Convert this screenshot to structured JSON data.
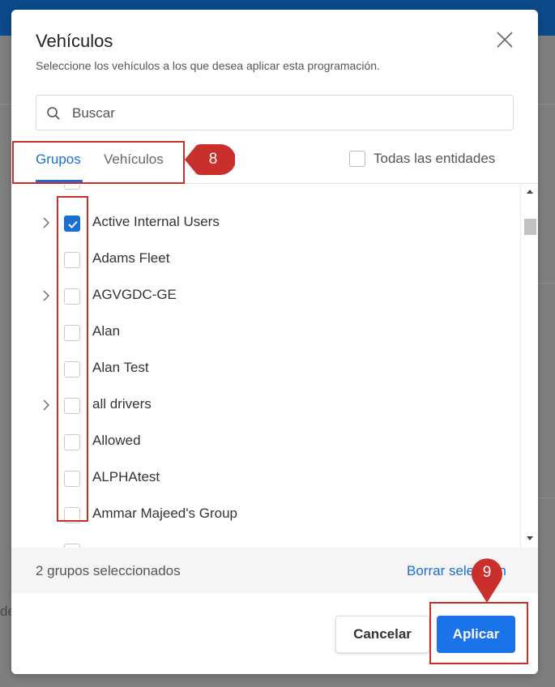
{
  "backdrop": {
    "partial_text": "de"
  },
  "dialog": {
    "title": "Vehículos",
    "subtitle": "Seleccione los vehículos a los que desea aplicar esta programación.",
    "close_icon": "close-icon"
  },
  "search": {
    "placeholder": "Buscar",
    "value": "",
    "icon": "search-icon"
  },
  "tabs": [
    {
      "label": "Grupos",
      "active": true
    },
    {
      "label": "Vehículos",
      "active": false
    }
  ],
  "all_entities": {
    "label": "Todas las entidades",
    "checked": false
  },
  "groups": [
    {
      "label": "Active Internal Users",
      "checked": true,
      "expandable": true
    },
    {
      "label": "Adams Fleet",
      "checked": false,
      "expandable": false
    },
    {
      "label": "AGVGDC-GE",
      "checked": false,
      "expandable": true
    },
    {
      "label": "Alan",
      "checked": false,
      "expandable": false
    },
    {
      "label": "Alan Test",
      "checked": false,
      "expandable": false
    },
    {
      "label": "all drivers",
      "checked": false,
      "expandable": true
    },
    {
      "label": "Allowed",
      "checked": false,
      "expandable": false
    },
    {
      "label": "ALPHAtest",
      "checked": false,
      "expandable": false
    },
    {
      "label": "Ammar Majeed's Group",
      "checked": false,
      "expandable": false
    }
  ],
  "footer": {
    "selected_count": "2 grupos seleccionados",
    "clear_selection": "Borrar selección"
  },
  "actions": {
    "cancel": "Cancelar",
    "apply": "Aplicar"
  },
  "annotations": [
    {
      "number": "8"
    },
    {
      "number": "9"
    }
  ],
  "colors": {
    "accent": "#1a6fd3",
    "apply_button": "#1a73e8",
    "annotation": "#c9302c",
    "header": "#0c4a8a"
  }
}
